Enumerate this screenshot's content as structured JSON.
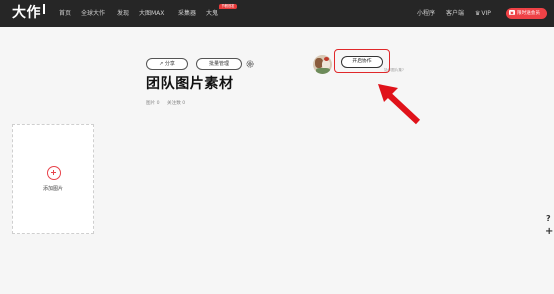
{
  "topnav": {
    "logo": "大作",
    "items": [
      "首页",
      "全球大作",
      "发现",
      "大图MAX",
      "采集器",
      "大鬼"
    ],
    "new_badge": "节假首发",
    "right_items": [
      "小程序",
      "客户端",
      "VIP"
    ],
    "gift_label": "限时送会员"
  },
  "header": {
    "share_label": "↗ 分享",
    "batch_label": "批量管理",
    "title": "团队图片素材",
    "stats": {
      "images": "图片 0",
      "followers": "关注数 0"
    }
  },
  "collab": {
    "button_label": "开启协作",
    "hint": "协作图片集?"
  },
  "add_card": {
    "label": "添加图片"
  },
  "side": {
    "help": "?",
    "plus": "+"
  },
  "colors": {
    "accent": "#e0282a",
    "nav_bg": "#262626",
    "page_bg": "#f6f6f6"
  }
}
